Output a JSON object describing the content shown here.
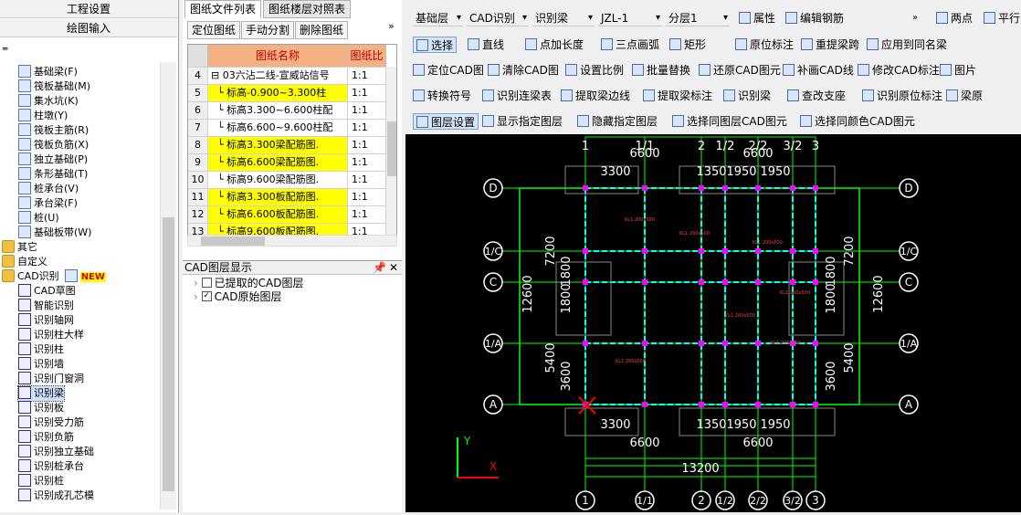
{
  "left_panel": {
    "header1": "工程设置",
    "header2": "绘图输入",
    "tree": [
      {
        "label": "基础梁(F)",
        "icon": "beam-icon"
      },
      {
        "label": "筏板基础(M)",
        "icon": "raft-icon"
      },
      {
        "label": "集水坑(K)",
        "icon": "sump-icon"
      },
      {
        "label": "柱墩(Y)",
        "icon": "pier-icon"
      },
      {
        "label": "筏板主筋(R)",
        "icon": "rebar-icon"
      },
      {
        "label": "筏板负筋(X)",
        "icon": "rebar-icon"
      },
      {
        "label": "独立基础(P)",
        "icon": "footing-icon"
      },
      {
        "label": "条形基础(T)",
        "icon": "strip-icon"
      },
      {
        "label": "桩承台(V)",
        "icon": "pilecap-icon"
      },
      {
        "label": "承台梁(F)",
        "icon": "capbeam-icon"
      },
      {
        "label": "桩(U)",
        "icon": "pile-icon"
      },
      {
        "label": "基础板带(W)",
        "icon": "band-icon"
      }
    ],
    "folders": [
      "其它",
      "自定义",
      "CAD识别"
    ],
    "new_badge": "NEW",
    "cad_items": [
      "CAD草图",
      "智能识别",
      "识别轴网",
      "识别柱大样",
      "识别柱",
      "识别墙",
      "识别门窗洞",
      "识别梁",
      "识别板",
      "识别受力筋",
      "识别负筋",
      "识别独立基础",
      "识别桩承台",
      "识别桩",
      "识别成孔芯模"
    ],
    "selected_cad_item": "识别梁"
  },
  "middle_panel": {
    "tabs": [
      "图纸文件列表",
      "图纸楼层对照表"
    ],
    "buttons": [
      "定位图纸",
      "手动分割",
      "删除图纸"
    ],
    "columns": [
      "图纸名称",
      "图纸比"
    ],
    "rows": [
      {
        "num": "4",
        "name": "03六沾二线-宣威站信号",
        "scale": "1:1",
        "highlight": false,
        "parent": true
      },
      {
        "num": "5",
        "name": "标高-0.900~3.300柱",
        "scale": "1:1",
        "highlight": true
      },
      {
        "num": "6",
        "name": "标高3.300~6.600柱配",
        "scale": "1:1",
        "highlight": false
      },
      {
        "num": "7",
        "name": "标高6.600~9.600柱配",
        "scale": "1:1",
        "highlight": false
      },
      {
        "num": "8",
        "name": "标高3.300梁配筋图.",
        "scale": "1:1",
        "highlight": true
      },
      {
        "num": "9",
        "name": "标高6.600梁配筋图.",
        "scale": "1:1",
        "highlight": true
      },
      {
        "num": "10",
        "name": "标高9.600梁配筋图.",
        "scale": "1:1",
        "highlight": false
      },
      {
        "num": "11",
        "name": "标高3.300板配筋图.",
        "scale": "1:1",
        "highlight": true
      },
      {
        "num": "12",
        "name": "标高6.600板配筋图.",
        "scale": "1:1",
        "highlight": true
      },
      {
        "num": "13",
        "name": "标高9.600板配筋图.",
        "scale": "1:1",
        "highlight": true
      }
    ],
    "layer_panel_title": "CAD图层显示",
    "layers": [
      {
        "label": "已提取的CAD图层",
        "checked": false
      },
      {
        "label": "CAD原始图层",
        "checked": true
      }
    ]
  },
  "toolbar": {
    "row1": {
      "floor": "基础层",
      "mode": "CAD识别",
      "submode": "识别梁",
      "component": "JZL-1",
      "layer": "分层1",
      "properties": "属性",
      "edit_rebar": "编辑钢筋",
      "two_points": "两点",
      "parallel": "平行"
    },
    "row2": [
      "选择",
      "直线",
      "点加长度",
      "三点画弧",
      "矩形",
      "原位标注",
      "重提梁跨",
      "应用到同名梁"
    ],
    "row3": [
      "定位CAD图",
      "清除CAD图",
      "设置比例",
      "批量替换",
      "还原CAD图元",
      "补画CAD线",
      "修改CAD标注",
      "图片"
    ],
    "row4": [
      "转换符号",
      "识别连梁表",
      "提取梁边线",
      "提取梁标注",
      "识别梁",
      "查改支座",
      "识别原位标注",
      "梁原"
    ],
    "row5": [
      "图层设置",
      "显示指定图层",
      "隐藏指定图层",
      "选择同图层CAD图元",
      "选择同颜色CAD图元"
    ]
  },
  "cad": {
    "dims_top": [
      "6600",
      "6600",
      "3300",
      "1350",
      "1950",
      "1950"
    ],
    "dims_bottom": [
      "3300",
      "1350",
      "1950",
      "1950",
      "6600",
      "6600",
      "13200"
    ],
    "axes_top": [
      "1",
      "1/1",
      "2",
      "1/2",
      "2/2",
      "3/2",
      "3"
    ],
    "axes_bottom": [
      "1",
      "1/1",
      "2",
      "1/2",
      "2/2",
      "3/2",
      "3"
    ],
    "axes_left": [
      "D",
      "1/C",
      "C",
      "1/A",
      "A"
    ],
    "axes_right": [
      "D",
      "1/C",
      "C",
      "1/A",
      "A"
    ],
    "dims_left": [
      "7200",
      "1800",
      "1800",
      "5400",
      "3600",
      "12600"
    ],
    "dims_right": [
      "7200",
      "1800",
      "1800",
      "5400",
      "3600",
      "12600"
    ],
    "ucs_x": "X",
    "ucs_y": "Y"
  }
}
